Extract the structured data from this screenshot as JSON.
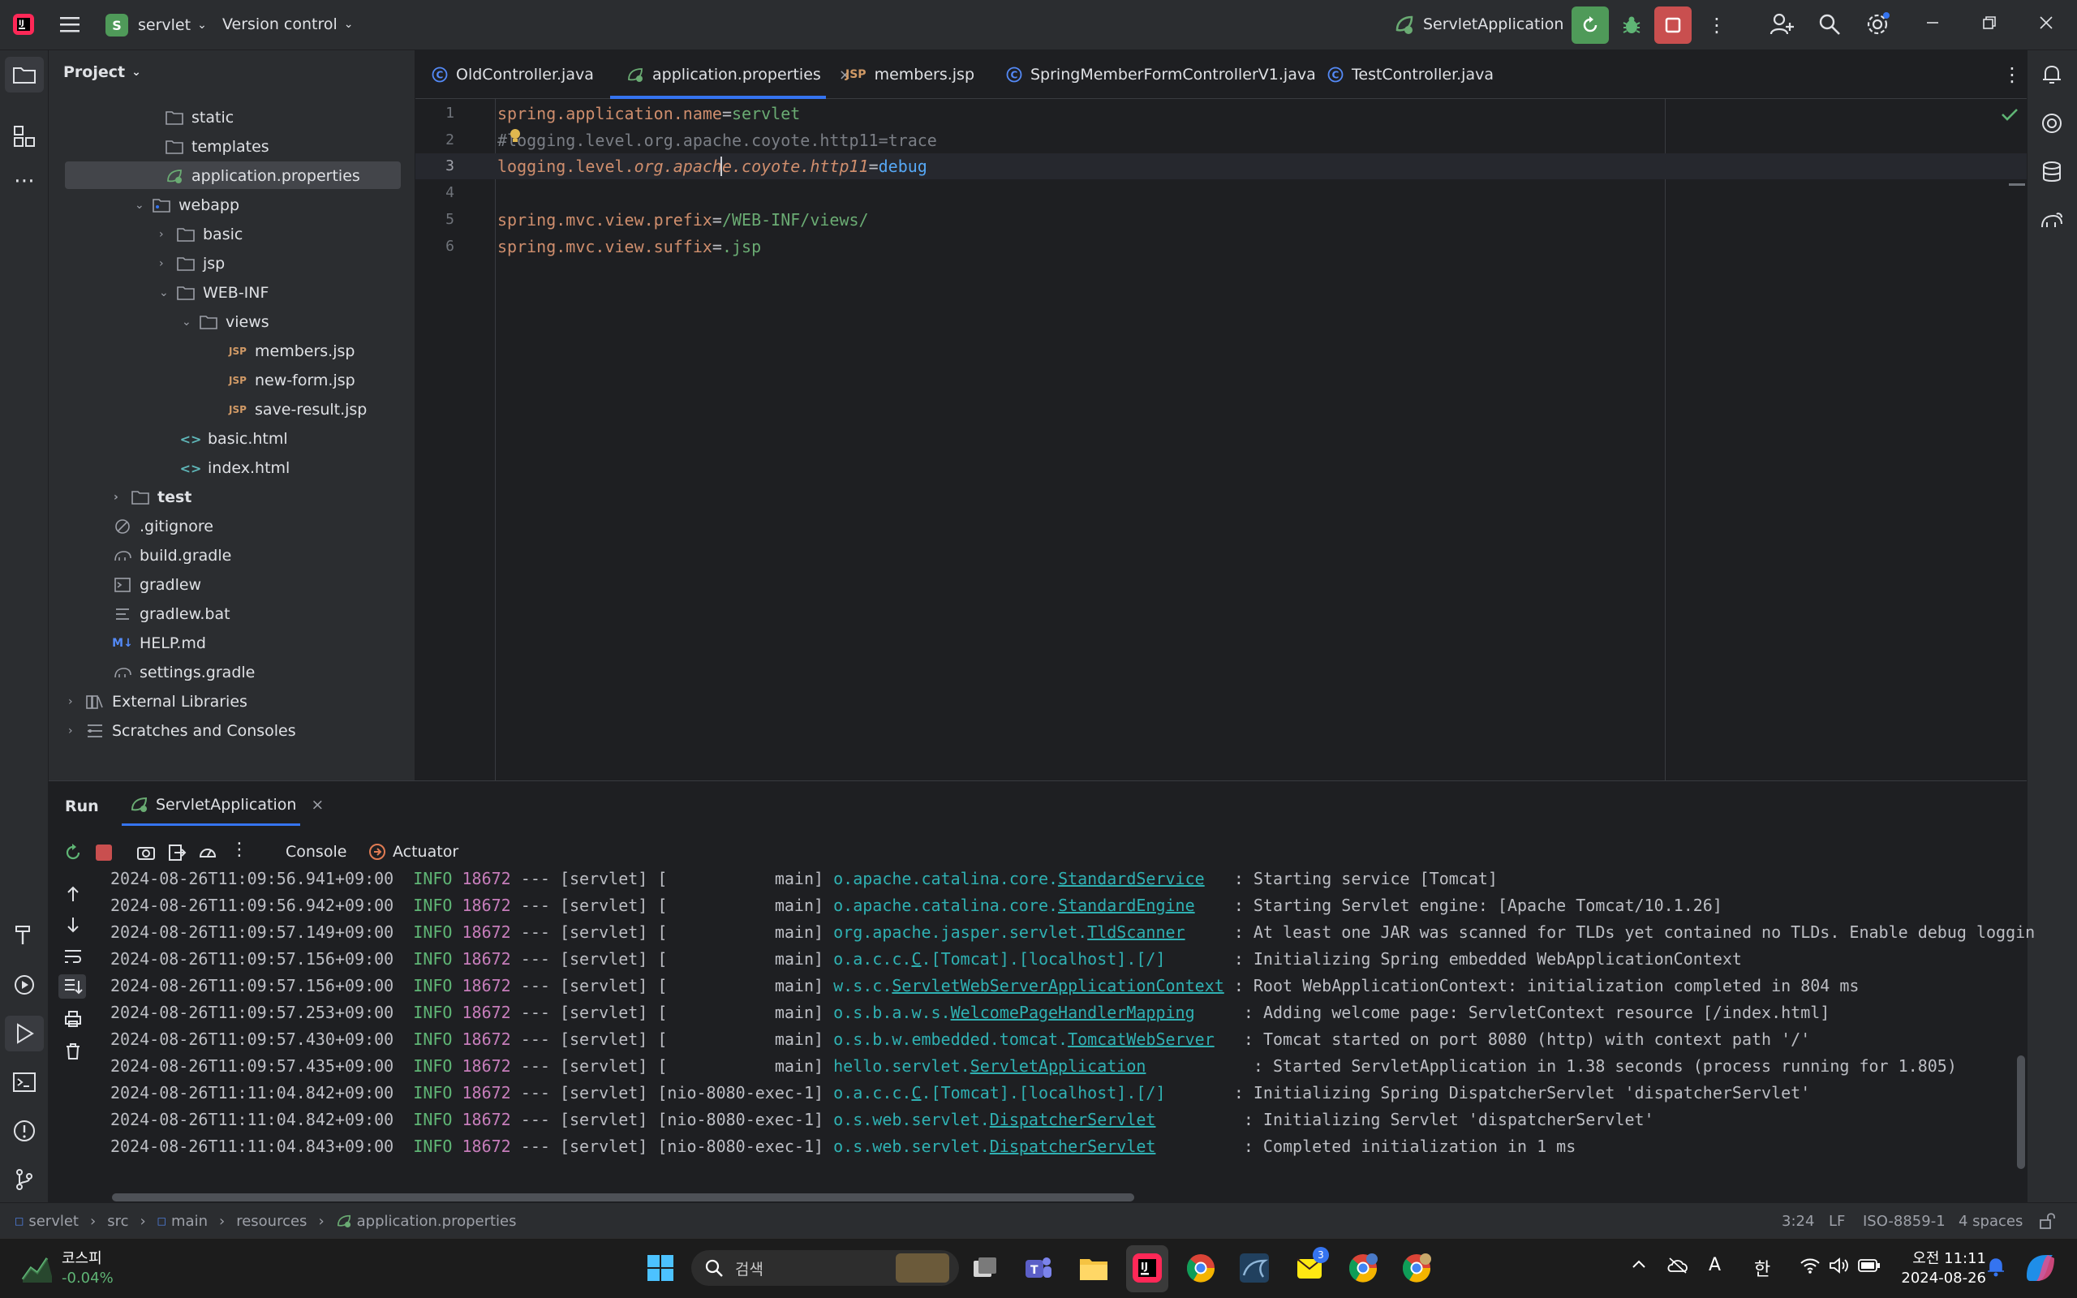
{
  "titlebar": {
    "project_badge": "S",
    "project_name": "servlet",
    "version_control": "Version control",
    "run_config": "ServletApplication"
  },
  "project_panel": {
    "title": "Project",
    "tree": [
      {
        "label": "static"
      },
      {
        "label": "templates"
      },
      {
        "label": "application.properties"
      },
      {
        "label": "webapp"
      },
      {
        "label": "basic"
      },
      {
        "label": "jsp"
      },
      {
        "label": "WEB-INF"
      },
      {
        "label": "views"
      },
      {
        "label": "members.jsp"
      },
      {
        "label": "new-form.jsp"
      },
      {
        "label": "save-result.jsp"
      },
      {
        "label": "basic.html"
      },
      {
        "label": "index.html"
      },
      {
        "label": "test"
      },
      {
        "label": ".gitignore"
      },
      {
        "label": "build.gradle"
      },
      {
        "label": "gradlew"
      },
      {
        "label": "gradlew.bat"
      },
      {
        "label": "HELP.md"
      },
      {
        "label": "settings.gradle"
      },
      {
        "label": "External Libraries"
      },
      {
        "label": "Scratches and Consoles"
      }
    ]
  },
  "tabs": [
    {
      "label": "OldController.java"
    },
    {
      "label": "application.properties",
      "active": true
    },
    {
      "label": "members.jsp"
    },
    {
      "label": "SpringMemberFormControllerV1.java"
    },
    {
      "label": "TestController.java"
    }
  ],
  "editor": {
    "lines": [
      {
        "n": "1",
        "key": "spring.application.name",
        "eq": "=",
        "value": "servlet"
      },
      {
        "n": "2",
        "text": "#logging.level.org.apache.coyote.http11=trace"
      },
      {
        "n": "3",
        "key": "logging.level.",
        "key_italic": "org.apache.coyote.http11",
        "eq": "=",
        "value": "debug"
      },
      {
        "n": "4",
        "text": ""
      },
      {
        "n": "5",
        "key": "spring.mvc.view.prefix",
        "eq": "=",
        "value": "/WEB-INF/views/"
      },
      {
        "n": "6",
        "key": "spring.mvc.view.suffix",
        "eq": "=",
        "value": ".jsp"
      }
    ]
  },
  "run_panel": {
    "title": "Run",
    "config_tab": "ServletApplication",
    "console_tab": "Console",
    "actuator_tab": "Actuator",
    "logs": [
      {
        "ts": "2024-08-26T11:09:56.941+09:00",
        "level": "INFO",
        "pid": "18672",
        "mid": "--- [servlet] [           main]",
        "cls_prefix": "o.apache.catalina.core.",
        "cls_name": "StandardService",
        "pad": "  ",
        "msg": ": Starting service [Tomcat]"
      },
      {
        "ts": "2024-08-26T11:09:56.942+09:00",
        "level": "INFO",
        "pid": "18672",
        "mid": "--- [servlet] [           main]",
        "cls_prefix": "o.apache.catalina.core.",
        "cls_name": "StandardEngine",
        "pad": "   ",
        "msg": ": Starting Servlet engine: [Apache Tomcat/10.1.26]"
      },
      {
        "ts": "2024-08-26T11:09:57.149+09:00",
        "level": "INFO",
        "pid": "18672",
        "mid": "--- [servlet] [           main]",
        "cls_prefix": "org.apache.jasper.servlet.",
        "cls_name": "TldScanner",
        "pad": "    ",
        "msg": ": At least one JAR was scanned for TLDs yet contained no TLDs. Enable debug loggin"
      },
      {
        "ts": "2024-08-26T11:09:57.156+09:00",
        "level": "INFO",
        "pid": "18672",
        "mid": "--- [servlet] [           main]",
        "cls_prefix": "o.a.c.c.",
        "cls_name": "C",
        "cls_suffix": ".[Tomcat].[localhost].[/]",
        "pad": "      ",
        "msg": ": Initializing Spring embedded WebApplicationContext"
      },
      {
        "ts": "2024-08-26T11:09:57.156+09:00",
        "level": "INFO",
        "pid": "18672",
        "mid": "--- [servlet] [           main]",
        "cls_prefix": "w.s.c.",
        "cls_name": "ServletWebServerApplicationContext",
        "pad": " ",
        "msg": ": Root WebApplicationContext: initialization completed in 804 ms"
      },
      {
        "ts": "2024-08-26T11:09:57.253+09:00",
        "level": "INFO",
        "pid": "18672",
        "mid": "--- [servlet] [           main]",
        "cls_prefix": "o.s.b.a.w.s.",
        "cls_name": "WelcomePageHandlerMapping",
        "pad": "    ",
        "msg": ": Adding welcome page: ServletContext resource [/index.html]"
      },
      {
        "ts": "2024-08-26T11:09:57.430+09:00",
        "level": "INFO",
        "pid": "18672",
        "mid": "--- [servlet] [           main]",
        "cls_prefix": "o.s.b.w.embedded.tomcat.",
        "cls_name": "TomcatWebServer",
        "pad": "  ",
        "msg": ": Tomcat started on port 8080 (http) with context path '/'"
      },
      {
        "ts": "2024-08-26T11:09:57.435+09:00",
        "level": "INFO",
        "pid": "18672",
        "mid": "--- [servlet] [           main]",
        "cls_prefix": "hello.servlet.",
        "cls_name": "ServletApplication",
        "pad": "          ",
        "msg": ": Started ServletApplication in 1.38 seconds (process running for 1.805)"
      },
      {
        "ts": "2024-08-26T11:11:04.842+09:00",
        "level": "INFO",
        "pid": "18672",
        "mid": "--- [servlet] [nio-8080-exec-1]",
        "cls_prefix": "o.a.c.c.",
        "cls_name": "C",
        "cls_suffix": ".[Tomcat].[localhost].[/]",
        "pad": "      ",
        "msg": ": Initializing Spring DispatcherServlet 'dispatcherServlet'"
      },
      {
        "ts": "2024-08-26T11:11:04.842+09:00",
        "level": "INFO",
        "pid": "18672",
        "mid": "--- [servlet] [nio-8080-exec-1]",
        "cls_prefix": "o.s.web.servlet.",
        "cls_name": "DispatcherServlet",
        "pad": "        ",
        "msg": ": Initializing Servlet 'dispatcherServlet'"
      },
      {
        "ts": "2024-08-26T11:11:04.843+09:00",
        "level": "INFO",
        "pid": "18672",
        "mid": "--- [servlet] [nio-8080-exec-1]",
        "cls_prefix": "o.s.web.servlet.",
        "cls_name": "DispatcherServlet",
        "pad": "        ",
        "msg": ": Completed initialization in 1 ms"
      }
    ]
  },
  "statusbar": {
    "breadcrumb": [
      "servlet",
      "src",
      "main",
      "resources",
      "application.properties"
    ],
    "position": "3:24",
    "line_sep": "LF",
    "encoding": "ISO-8859-1",
    "indent": "4 spaces"
  },
  "taskbar": {
    "stock_name": "코스피",
    "stock_change": "-0.04%",
    "search_placeholder": "검색",
    "ime_a": "A",
    "ime_ko": "한",
    "clock_time": "오전 11:11",
    "clock_date": "2024-08-26",
    "teams_badge": "3"
  },
  "colors": {
    "accent": "#3574f0",
    "run_green": "#4f9a59",
    "stop_red": "#c94f4f",
    "info_green": "#5fb575",
    "pid_purple": "#c77dbb",
    "class_cyan": "#2fb1b3",
    "key_orange": "#cf8e6d",
    "value_green": "#6aab73"
  }
}
